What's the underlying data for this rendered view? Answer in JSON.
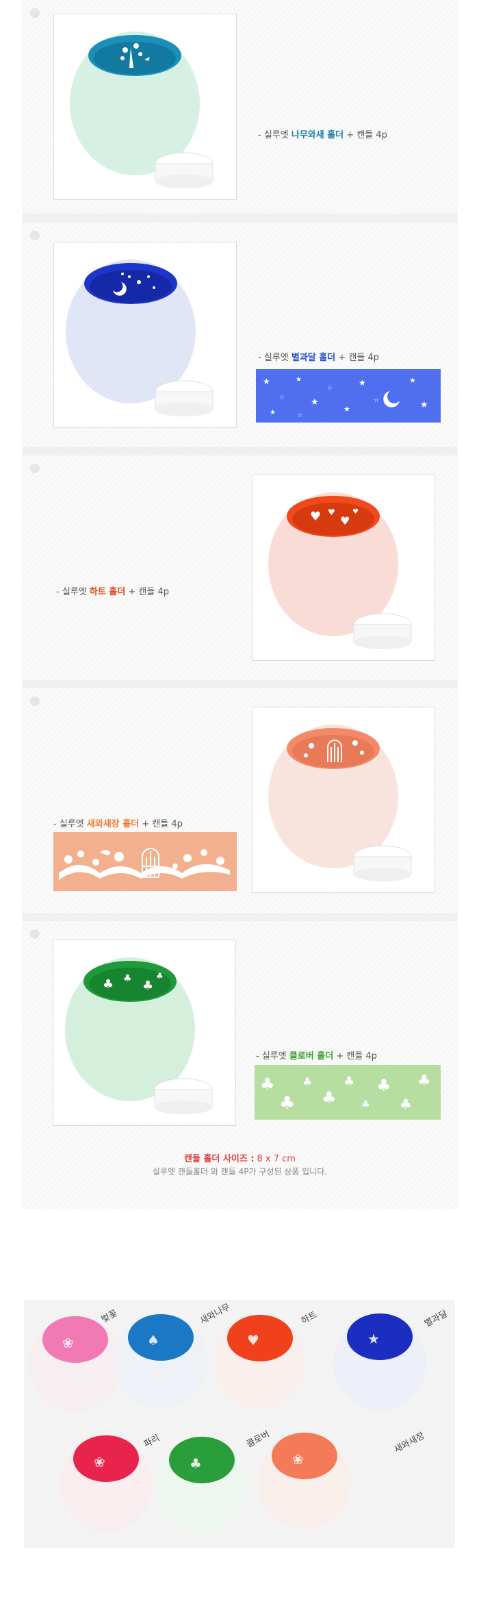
{
  "products": [
    {
      "prefix": "- 실루엣",
      "name": "나무와새 홀더",
      "name_color": "#1a7fa8",
      "suffix": "+ 캔들 4p",
      "glass_color": "#cfeee0",
      "inner_color": "#1590b8",
      "icon": "tree-bird-icon"
    },
    {
      "prefix": "- 실루엣",
      "name": "별과달 홀더",
      "name_color": "#2a4fd0",
      "suffix": "+ 캔들 4p",
      "glass_color": "#dde3f5",
      "inner_color": "#1a34c8",
      "icon": "star-moon-icon",
      "pattern_color": "#4f6ff0"
    },
    {
      "prefix": "- 실루엣",
      "name": "하트 홀더",
      "name_color": "#e8431a",
      "suffix": "+ 캔들 4p",
      "glass_color": "#f8dcd8",
      "inner_color": "#f04a1c",
      "icon": "heart-icon"
    },
    {
      "prefix": "- 실루엣",
      "name": "새와새장 홀더",
      "name_color": "#f07828",
      "suffix": "+ 캔들 4p",
      "glass_color": "#f9e2dc",
      "inner_color": "#f28a6a",
      "icon": "birdcage-icon",
      "pattern_color": "#f3b08e"
    },
    {
      "prefix": "- 실루엣",
      "name": "클로버 홀더",
      "name_color": "#3aa12a",
      "suffix": "+ 캔들 4p",
      "glass_color": "#d6f0df",
      "inner_color": "#1f9a3a",
      "icon": "clover-icon",
      "pattern_color": "#b5dea0"
    }
  ],
  "size": {
    "label": "캔들 홀더 사이즈 :",
    "value": "8 x 7 cm",
    "description": "실루엣 캔들홀더 와 캔들 4P가 구성된 상품 입니다."
  },
  "lineup": {
    "captions": [
      "벚꽃",
      "새와나무",
      "하트",
      "별과달",
      "파리",
      "클로버",
      "새와새장"
    ],
    "colors": [
      "#f27ab4",
      "#1a78c4",
      "#f0401c",
      "#1a2fc0",
      "#e8244c",
      "#2a9e3a",
      "#f47a58"
    ]
  }
}
